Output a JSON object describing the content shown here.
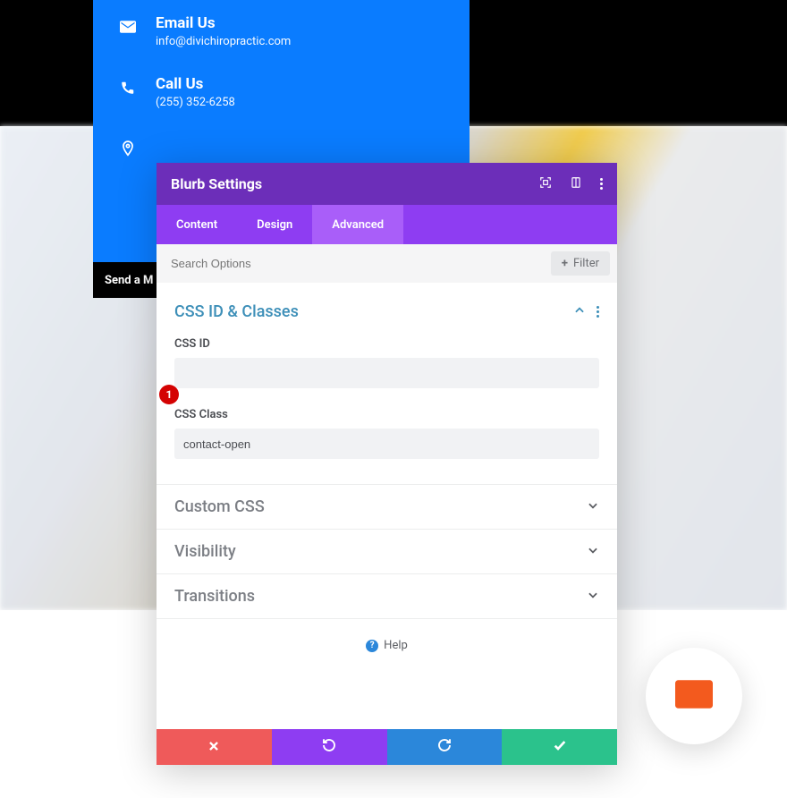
{
  "contact": {
    "email": {
      "title": "Email Us",
      "value": "info@divichiropractic.com"
    },
    "phone": {
      "title": "Call Us",
      "value": "(255) 352-6258"
    },
    "location": {
      "title": "",
      "value": ""
    }
  },
  "send_message_label": "Send a M",
  "panel": {
    "title": "Blurb Settings",
    "tabs": {
      "content": "Content",
      "design": "Design",
      "advanced": "Advanced"
    },
    "search_placeholder": "Search Options",
    "filter_label": "Filter",
    "sections": {
      "css_id_classes": {
        "title": "CSS ID & Classes",
        "css_id_label": "CSS ID",
        "css_id_value": "",
        "css_class_label": "CSS Class",
        "css_class_value": "contact-open"
      },
      "custom_css": {
        "title": "Custom CSS"
      },
      "visibility": {
        "title": "Visibility"
      },
      "transitions": {
        "title": "Transitions"
      }
    },
    "help_label": "Help"
  },
  "marker": {
    "number": "1"
  }
}
